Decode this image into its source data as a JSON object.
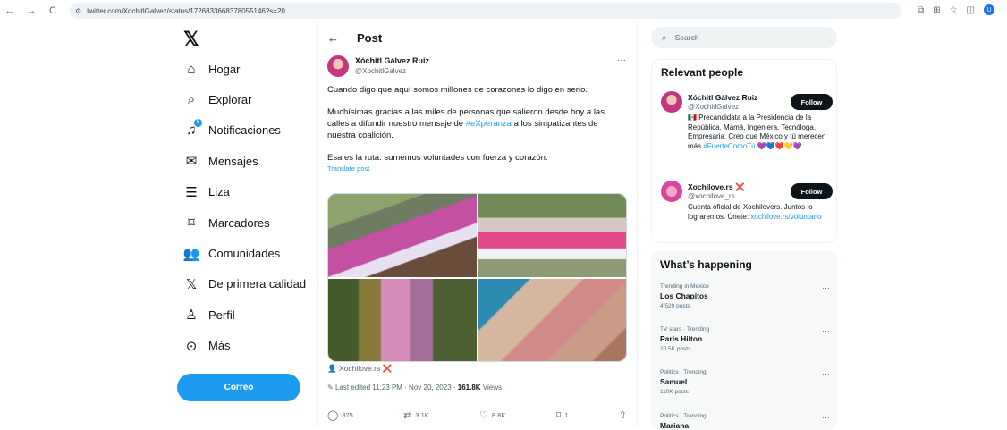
{
  "browser": {
    "url": "twitter.com/XochitlGalvez/status/1726833668378055146?s=20",
    "back": "←",
    "forward": "→",
    "reload": "C",
    "profile_initial": "U"
  },
  "nav": {
    "logo": "𝕏",
    "items": [
      {
        "label": "Hogar",
        "icon": "⌂"
      },
      {
        "label": "Explorar",
        "icon": "⌕"
      },
      {
        "label": "Notificaciones",
        "icon": "♫",
        "badge": "5"
      },
      {
        "label": "Mensajes",
        "icon": "✉"
      },
      {
        "label": "Liza",
        "icon": "☰"
      },
      {
        "label": "Marcadores",
        "icon": "⌑"
      },
      {
        "label": "Comunidades",
        "icon": "👥"
      },
      {
        "label": "De primera calidad",
        "icon": "𝕏"
      },
      {
        "label": "Perfil",
        "icon": "♙"
      },
      {
        "label": "Más",
        "icon": "⊙"
      }
    ],
    "cta": "Correo"
  },
  "post": {
    "header": "Post",
    "back": "←",
    "author_name": "Xóchitl Gálvez Ruiz",
    "author_handle": "@XochitlGalvez",
    "more": "···",
    "text1": "Cuando digo que aquí somos millones de corazones lo digo en serio.",
    "text2a": "Muchísimas gracias a las miles de personas que salieron desde hoy a las calles a difundir nuestro mensaje de ",
    "hashtag": "#eXperanza",
    "text2b": " a los simpatizantes de nuestra coalición.",
    "text3": "Esa es la ruta: sumemos voluntades con fuerza y corazón.",
    "translate": "Translate post",
    "media_credit": "Xochilove.rs",
    "media_credit_x": "❌",
    "edited": "Last edited 11:23 PM · Nov 20, 2023 · ",
    "views": "161.8K",
    "views_label": " Views",
    "replies": "875",
    "reposts": "3.1K",
    "likes": "8.8K",
    "bookmarks": "1",
    "reply_icon": "◯",
    "repost_icon": "⇄",
    "like_icon": "♡",
    "bookmark_icon": "⌑",
    "share_icon": "⇧"
  },
  "sidebar": {
    "search_placeholder": "Search",
    "relevant_title": "Relevant people",
    "people": [
      {
        "name": "Xóchitl Gálvez Ruiz",
        "handle": "@XochitlGalvez",
        "follow": "Follow",
        "bio": "🇲🇽 Precandidata a la Presidencia de la República. Mamá. Ingeniera. Tecnóloga. Empresaria. Creo que México y tú merecen más ",
        "bio_link": "#FuerteComoTú",
        "bio_end": " 💜💙❤️💛💜"
      },
      {
        "name": "Xochilove.rs",
        "name_x": "❌",
        "handle": "@xochilove_rs",
        "follow": "Follow",
        "bio": "Cuenta oficial de Xochilovers. Juntos lo lograremos. Únete: ",
        "bio_link": "xochilove.rs/voluntario",
        "bio_end": ""
      }
    ],
    "happening_title": "What’s happening",
    "trends": [
      {
        "context": "Trending in Mexico",
        "name": "Los Chapitos",
        "count": "4,520 posts"
      },
      {
        "context": "TV stars · Trending",
        "name": "Paris Hilton",
        "count": "20.5K posts"
      },
      {
        "context": "Politics · Trending",
        "name": "Samuel",
        "count": "110K posts"
      },
      {
        "context": "Politics · Trending",
        "name": "Mariana",
        "count": ""
      }
    ],
    "trend_more": "···"
  }
}
